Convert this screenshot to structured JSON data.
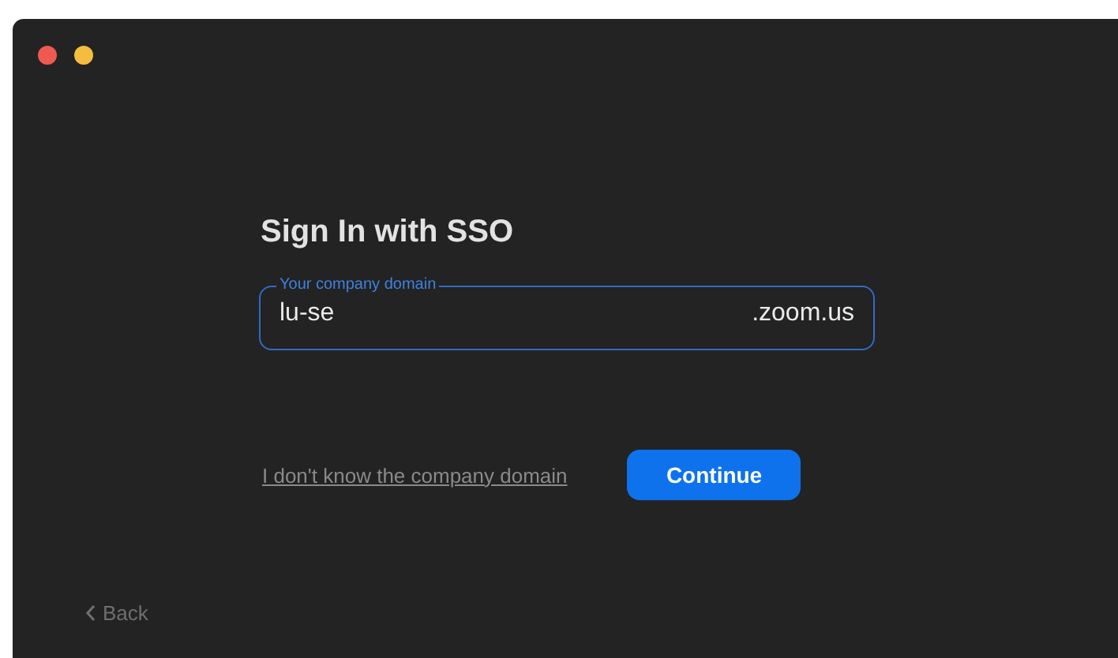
{
  "title": "Sign In with SSO",
  "domain_field": {
    "label": "Your company domain",
    "value": "lu-se",
    "suffix": ".zoom.us"
  },
  "help_link": "I don't know the company domain",
  "continue_button": "Continue",
  "back_button": "Back"
}
